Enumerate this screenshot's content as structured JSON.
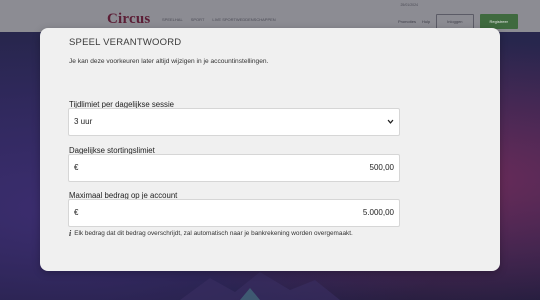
{
  "site": {
    "logo": "Circus",
    "nav": [
      "Speelhal",
      "Sport",
      "Live Sportweddenschappen"
    ],
    "top_links": [
      "Promoties",
      "Hulp"
    ],
    "login_label": "Inloggen",
    "register_label": "Registreer",
    "date": "25/01/2024"
  },
  "modal": {
    "title": "SPEEL VERANTWOORD",
    "description": "Je kan deze voorkeuren later altijd wijzigen in je accountinstellingen.",
    "session": {
      "label": "Tijdlimiet per dagelijkse sessie",
      "selected": "3 uur"
    },
    "deposit": {
      "label": "Dagelijkse stortingslimiet",
      "currency": "€",
      "value": "500,00"
    },
    "max_account": {
      "label": "Maximaal bedrag op je account",
      "currency": "€",
      "value": "5.000,00"
    },
    "note": "Elk bedrag dat dit bedrag overschrijdt, zal automatisch naar je bankrekening worden overgemaakt."
  },
  "icons": {
    "select_arrow": "chevron-down-icon",
    "info": "info-icon"
  },
  "colors": {
    "modal_bg": "#f0f0f0",
    "site_bg": "#2a2a4a",
    "register_button": "#3f6a3f"
  }
}
